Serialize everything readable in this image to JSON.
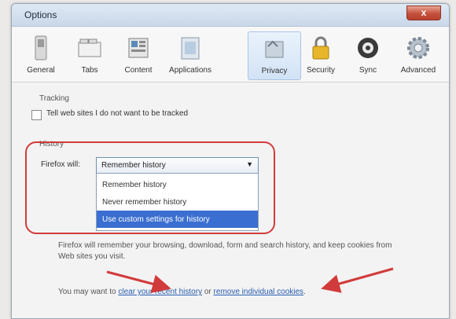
{
  "window": {
    "title": "Options",
    "close_symbol": "x"
  },
  "toolbar": {
    "items": [
      {
        "label": "General",
        "icon": "switch-icon"
      },
      {
        "label": "Tabs",
        "icon": "tabs-icon"
      },
      {
        "label": "Content",
        "icon": "content-icon"
      },
      {
        "label": "Applications",
        "icon": "applications-icon"
      },
      {
        "label": "Privacy",
        "icon": "privacy-icon",
        "selected": true
      },
      {
        "label": "Security",
        "icon": "lock-icon"
      },
      {
        "label": "Sync",
        "icon": "sync-icon"
      },
      {
        "label": "Advanced",
        "icon": "gear-icon"
      }
    ]
  },
  "tracking": {
    "heading": "Tracking",
    "checkbox_label": "Tell web sites I do not want to be tracked",
    "checked": false
  },
  "history": {
    "heading": "History",
    "combo_label": "Firefox will:",
    "selected_value": "Remember history",
    "options": [
      "Remember history",
      "Never remember history",
      "Use custom settings for history"
    ],
    "highlighted_option": "Use custom settings for history",
    "description": "Firefox will remember your browsing, download, form and search history, and keep cookies from Web sites you visit.",
    "footer_prefix": "You may want to",
    "link_clear": "clear your recent history",
    "footer_or": "or",
    "link_remove": "remove individual cookies",
    "footer_suffix": "."
  },
  "colors": {
    "highlight": "#d23b3b",
    "link": "#2a5db0",
    "selection": "#3a6ed0"
  }
}
